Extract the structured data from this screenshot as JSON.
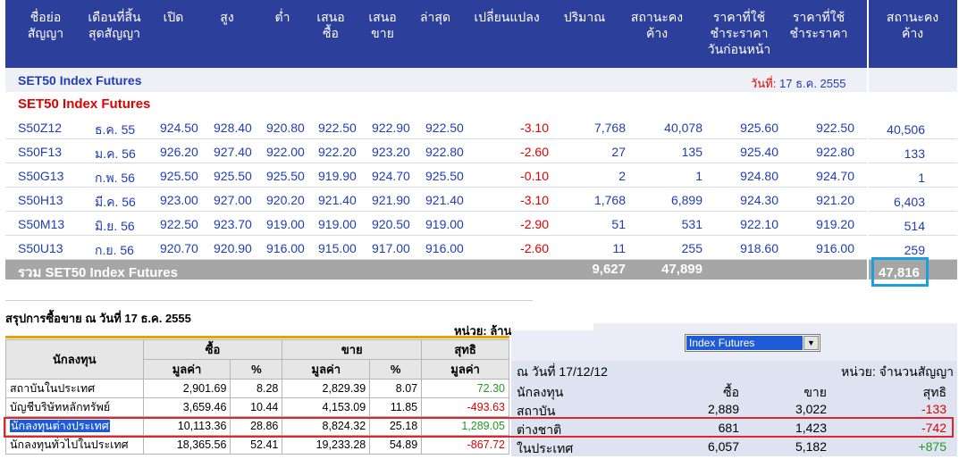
{
  "headers": {
    "series": "ชื่อย่อ\nสัญญา",
    "last_date": "เดือนที่สิ้น\nสุดสัญญา",
    "open": "เปิด",
    "high": "สูง",
    "low": "ต่ำ",
    "bid": "เสนอ\nซื้อ",
    "offer": "เสนอ\nขาย",
    "last": "ล่าสุด",
    "change": "เปลี่ยนแปลง",
    "volume": "ปริมาณ",
    "oi": "สถานะคง\nค้าง",
    "prev_settle": "ราคาที่ใช้\nชำระราคา\nวันก่อนหน้า",
    "settle": "ราคาที่ใช้\nชำระราคา",
    "oi_right": "สถานะคง\nค้าง"
  },
  "section1": "SET50 Index Futures",
  "date_label": "วันที่:",
  "date_value": "17 ธ.ค. 2555",
  "section2": "SET50 Index Futures",
  "rows": [
    {
      "series": "S50Z12",
      "month": "ธ.ค. 55",
      "open": "924.50",
      "high": "928.40",
      "low": "920.80",
      "bid": "922.50",
      "offer": "922.90",
      "last": "922.50",
      "change": "-3.10",
      "volume": "7,768",
      "oi": "40,078",
      "prev": "925.60",
      "settle": "922.50",
      "oi_right": "40,506"
    },
    {
      "series": "S50F13",
      "month": "ม.ค. 56",
      "open": "926.20",
      "high": "927.40",
      "low": "922.00",
      "bid": "922.20",
      "offer": "923.20",
      "last": "922.80",
      "change": "-2.60",
      "volume": "27",
      "oi": "135",
      "prev": "925.40",
      "settle": "922.80",
      "oi_right": "133"
    },
    {
      "series": "S50G13",
      "month": "ก.พ. 56",
      "open": "925.50",
      "high": "925.50",
      "low": "925.50",
      "bid": "919.90",
      "offer": "924.70",
      "last": "925.50",
      "change": "-0.10",
      "volume": "2",
      "oi": "1",
      "prev": "924.80",
      "settle": "924.70",
      "oi_right": "1"
    },
    {
      "series": "S50H13",
      "month": "มี.ค. 56",
      "open": "923.00",
      "high": "927.00",
      "low": "920.20",
      "bid": "921.40",
      "offer": "921.90",
      "last": "921.40",
      "change": "-3.10",
      "volume": "1,768",
      "oi": "6,899",
      "prev": "924.30",
      "settle": "921.20",
      "oi_right": "6,403"
    },
    {
      "series": "S50M13",
      "month": "มิ.ย. 56",
      "open": "922.50",
      "high": "923.70",
      "low": "919.00",
      "bid": "919.00",
      "offer": "920.50",
      "last": "919.00",
      "change": "-2.90",
      "volume": "51",
      "oi": "531",
      "prev": "922.10",
      "settle": "919.20",
      "oi_right": "514"
    },
    {
      "series": "S50U13",
      "month": "ก.ย. 56",
      "open": "920.70",
      "high": "920.90",
      "low": "916.00",
      "bid": "915.00",
      "offer": "917.00",
      "last": "916.00",
      "change": "-2.60",
      "volume": "11",
      "oi": "255",
      "prev": "918.60",
      "settle": "916.00",
      "oi_right": "259"
    }
  ],
  "total": {
    "label": "รวม SET50 Index Futures",
    "volume": "9,627",
    "oi": "47,899",
    "oi_right": "47,816"
  },
  "summary": {
    "title": "สรุปการซื้อขาย ณ วันที่ 17 ธ.ค. 2555",
    "unit": "หน่วย: ล้าน",
    "head": {
      "investor": "นักลงทุน",
      "buy": "ซื้อ",
      "sell": "ขาย",
      "net": "สุทธิ",
      "value": "มูลค่า",
      "pct": "%"
    },
    "rows": [
      {
        "name": "สถาบันในประเทศ",
        "buy": "2,901.69",
        "buy_pct": "8.28",
        "sell": "2,829.39",
        "sell_pct": "8.07",
        "net": "72.30",
        "pos": true
      },
      {
        "name": "บัญชีบริษัทหลักทรัพย์",
        "buy": "3,659.46",
        "buy_pct": "10.44",
        "sell": "4,153.09",
        "sell_pct": "11.85",
        "net": "-493.63",
        "pos": false
      },
      {
        "name": "นักลงทุนต่างประเทศ",
        "buy": "10,113.36",
        "buy_pct": "28.86",
        "sell": "8,824.32",
        "sell_pct": "25.18",
        "net": "1,289.05",
        "pos": true
      },
      {
        "name": "นักลงทุนทั่วไปในประเทศ",
        "buy": "18,365.56",
        "buy_pct": "52.41",
        "sell": "19,233.28",
        "sell_pct": "54.89",
        "net": "-867.72",
        "pos": false
      }
    ]
  },
  "panel": {
    "dropdown": "Index Futures",
    "date": "ณ วันที่ 17/12/12",
    "unit": "หน่วย: จำนวนสัญญา",
    "head": {
      "investor": "นักลงทุน",
      "buy": "ซื้อ",
      "sell": "ขาย",
      "net": "สุทธิ"
    },
    "rows": [
      {
        "name": "สถาบัน",
        "buy": "2,889",
        "sell": "3,022",
        "net": "-133",
        "pos": false
      },
      {
        "name": "ต่างชาติ",
        "buy": "681",
        "sell": "1,423",
        "net": "-742",
        "pos": false
      },
      {
        "name": "ในประเทศ",
        "buy": "6,057",
        "sell": "5,182",
        "net": "+875",
        "pos": true
      }
    ]
  },
  "colors": {
    "header_blue": "#2b3f9b",
    "value_blue": "#1f3db5",
    "negative": "#e00000",
    "positive": "#1f9a1f",
    "highlight_box": "#1aa0e0",
    "red_box": "#e0262a"
  }
}
